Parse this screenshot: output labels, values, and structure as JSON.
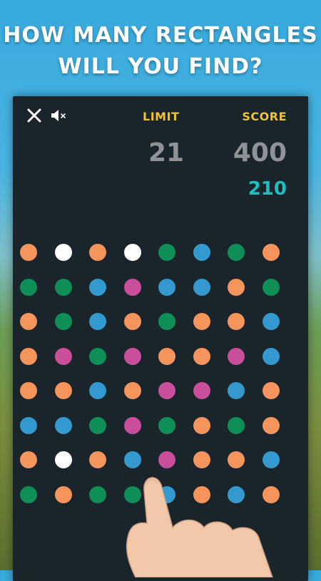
{
  "headline": {
    "line1": "HOW MANY RECTANGLES",
    "line2": "WILL YOU FIND?"
  },
  "toolbar": {
    "close_icon": "close-icon",
    "sound_icon": "speaker-muted-icon"
  },
  "stats": {
    "limit_label": "LIMIT",
    "limit_value": "21",
    "score_label": "SCORE",
    "score_value": "400",
    "target_value": "210"
  },
  "colors": {
    "orange": "#f6945e",
    "white": "#ffffff",
    "green": "#0f8e58",
    "blue": "#3399cf",
    "pink": "#c94f9c",
    "label_yellow": "#f2c232",
    "panel_bg": "#19242b",
    "target_teal": "#1fbfc1"
  },
  "board": {
    "rows": [
      [
        "orange",
        "white",
        "orange",
        "white",
        "green",
        "blue",
        "green",
        "orange"
      ],
      [
        "green",
        "green",
        "blue",
        "pink",
        "blue",
        "blue",
        "orange",
        "green"
      ],
      [
        "orange",
        "green",
        "blue",
        "orange",
        "green",
        "orange",
        "orange",
        "blue"
      ],
      [
        "orange",
        "pink",
        "green",
        "pink",
        "orange",
        "orange",
        "pink",
        "blue"
      ],
      [
        "orange",
        "orange",
        "blue",
        "orange",
        "pink",
        "pink",
        "blue",
        "orange"
      ],
      [
        "blue",
        "blue",
        "green",
        "pink",
        "green",
        "orange",
        "green",
        "orange"
      ],
      [
        "orange",
        "white",
        "orange",
        "blue",
        "pink",
        "orange",
        "orange",
        "blue"
      ],
      [
        "green",
        "orange",
        "green",
        "green",
        "blue",
        "orange",
        "blue",
        "orange"
      ]
    ]
  }
}
